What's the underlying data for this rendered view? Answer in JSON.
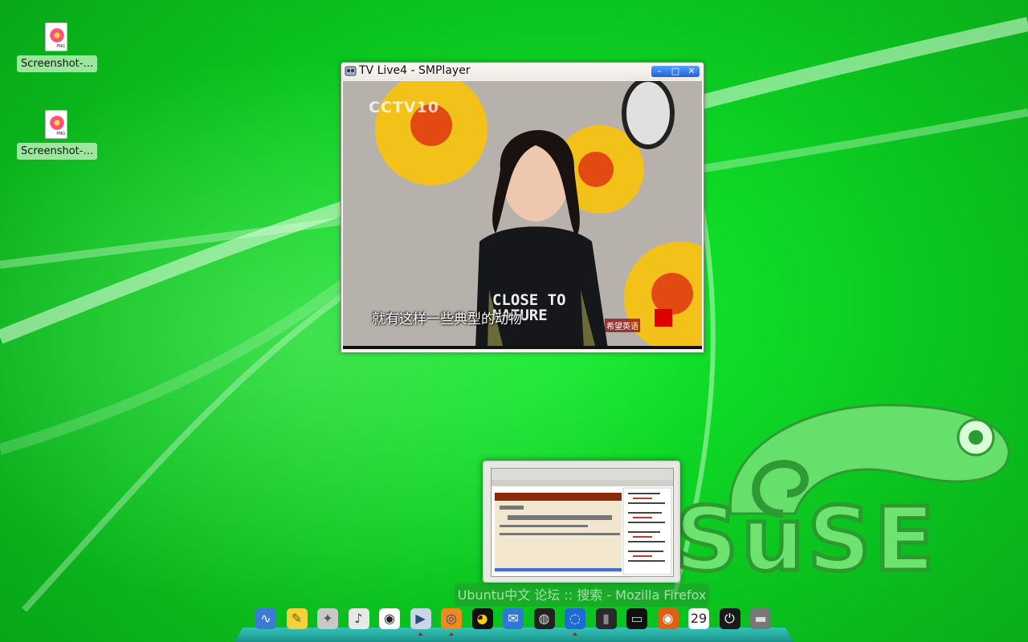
{
  "desktop": {
    "icons": [
      {
        "label": "Screenshot-…",
        "icon": "png-image-icon",
        "badge": "PNG"
      },
      {
        "label": "Screenshot-…",
        "icon": "png-image-icon",
        "badge": "PNG"
      }
    ],
    "wallpaper": {
      "brand": "SuSE",
      "base_color": "#0bc41f"
    }
  },
  "window": {
    "title": "TV Live4 - SMPlayer",
    "buttons": {
      "minimize": "–",
      "maximize": "□",
      "close": "✕"
    },
    "video": {
      "channel_logo": "CCTV10",
      "subtitle": "就有这样一些典型的动物",
      "shirt_text": "CLOSE TO\nNATURE",
      "program_logo": "希望英语"
    }
  },
  "taskbar_preview": {
    "tooltip": "Ubuntu中文 论坛 :: 搜索 - Mozilla Firefox"
  },
  "dock": {
    "items": [
      {
        "name": "system-monitor-icon",
        "glyph": "∿",
        "bg": "#3a7bd5",
        "fg": "#ffffff",
        "active": false
      },
      {
        "name": "notes-icon",
        "glyph": "✎",
        "bg": "#f3d23a",
        "fg": "#7a5a00",
        "active": false
      },
      {
        "name": "gimp-icon",
        "glyph": "✦",
        "bg": "#c8c8c8",
        "fg": "#5a5a5a",
        "active": false
      },
      {
        "name": "speaker-icon",
        "glyph": "♪",
        "bg": "#e8e8e8",
        "fg": "#444444",
        "active": false
      },
      {
        "name": "chat-bubble-icon",
        "glyph": "◉",
        "bg": "#ffffff",
        "fg": "#222222",
        "active": false
      },
      {
        "name": "smplayer-icon",
        "glyph": "▶",
        "bg": "#c9d7e8",
        "fg": "#2a4a7a",
        "active": true
      },
      {
        "name": "firefox-icon",
        "glyph": "◎",
        "bg": "#f08a1c",
        "fg": "#1c4aa8",
        "active": true
      },
      {
        "name": "qq-penguin-icon",
        "glyph": "◕",
        "bg": "#111111",
        "fg": "#ffcc00",
        "active": false
      },
      {
        "name": "thunderbird-icon",
        "glyph": "✉",
        "bg": "#2f78d8",
        "fg": "#ffffff",
        "active": false
      },
      {
        "name": "network-sphere-icon",
        "glyph": "◍",
        "bg": "#222222",
        "fg": "#dddddd",
        "active": false
      },
      {
        "name": "globe-icon",
        "glyph": "◌",
        "bg": "#1e6ad6",
        "fg": "#e6f0ff",
        "active": true
      },
      {
        "name": "window-switcher-icon",
        "glyph": "▮",
        "bg": "#2a2a2a",
        "fg": "#888888",
        "active": false
      },
      {
        "name": "terminal-icon",
        "glyph": "▭",
        "bg": "#111111",
        "fg": "#cccccc",
        "active": false
      },
      {
        "name": "ubuntu-logo-icon",
        "glyph": "◉",
        "bg": "#e35d14",
        "fg": "#ffffff",
        "active": false
      },
      {
        "name": "calendar-icon",
        "glyph": "29",
        "bg": "#ffffff",
        "fg": "#222222",
        "active": false
      },
      {
        "name": "power-icon",
        "glyph": "⏻",
        "bg": "#1a1a1a",
        "fg": "#ffffff",
        "active": false
      },
      {
        "name": "drive-icon",
        "glyph": "▬",
        "bg": "#777777",
        "fg": "#dddddd",
        "active": false
      }
    ]
  }
}
